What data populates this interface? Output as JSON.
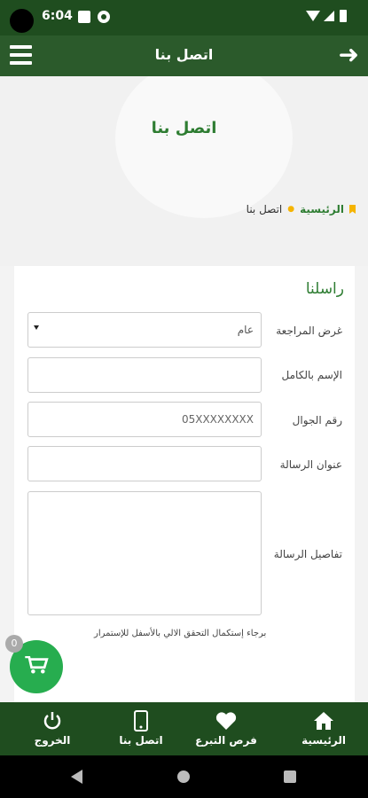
{
  "status_bar": {
    "time": "6:04"
  },
  "app_bar": {
    "title": "اتصل بنا"
  },
  "hero": {
    "title": "اتصل بنا",
    "breadcrumb_home": "الرئيسية",
    "breadcrumb_current": "اتصل بنا"
  },
  "form": {
    "title": "راسلنا",
    "purpose": {
      "label": "غرض المراجعة",
      "value": "عام"
    },
    "full_name": {
      "label": "الإسم بالكامل",
      "value": ""
    },
    "mobile": {
      "label": "رقم الجوال",
      "placeholder": "05XXXXXXXX"
    },
    "subject": {
      "label": "عنوان الرسالة",
      "value": ""
    },
    "details": {
      "label": "تفاصيل الرسالة",
      "value": ""
    },
    "captcha_note": "برجاء إستكمال التحقق الالي بالأسفل للإستمرار"
  },
  "cart": {
    "count": "0"
  },
  "bottom_nav": [
    {
      "label": "الرئيسية",
      "icon": "home-icon"
    },
    {
      "label": "فرص التبرع",
      "icon": "heart-icon"
    },
    {
      "label": "اتصل بنا",
      "icon": "phone-icon"
    },
    {
      "label": "الخروج",
      "icon": "power-icon"
    }
  ],
  "colors": {
    "primary_dark": "#1f4d1f",
    "primary": "#2b5a2b",
    "accent_green": "#2e7d32",
    "cart_green": "#27ad4f",
    "bookmark_yellow": "#f5b400"
  }
}
